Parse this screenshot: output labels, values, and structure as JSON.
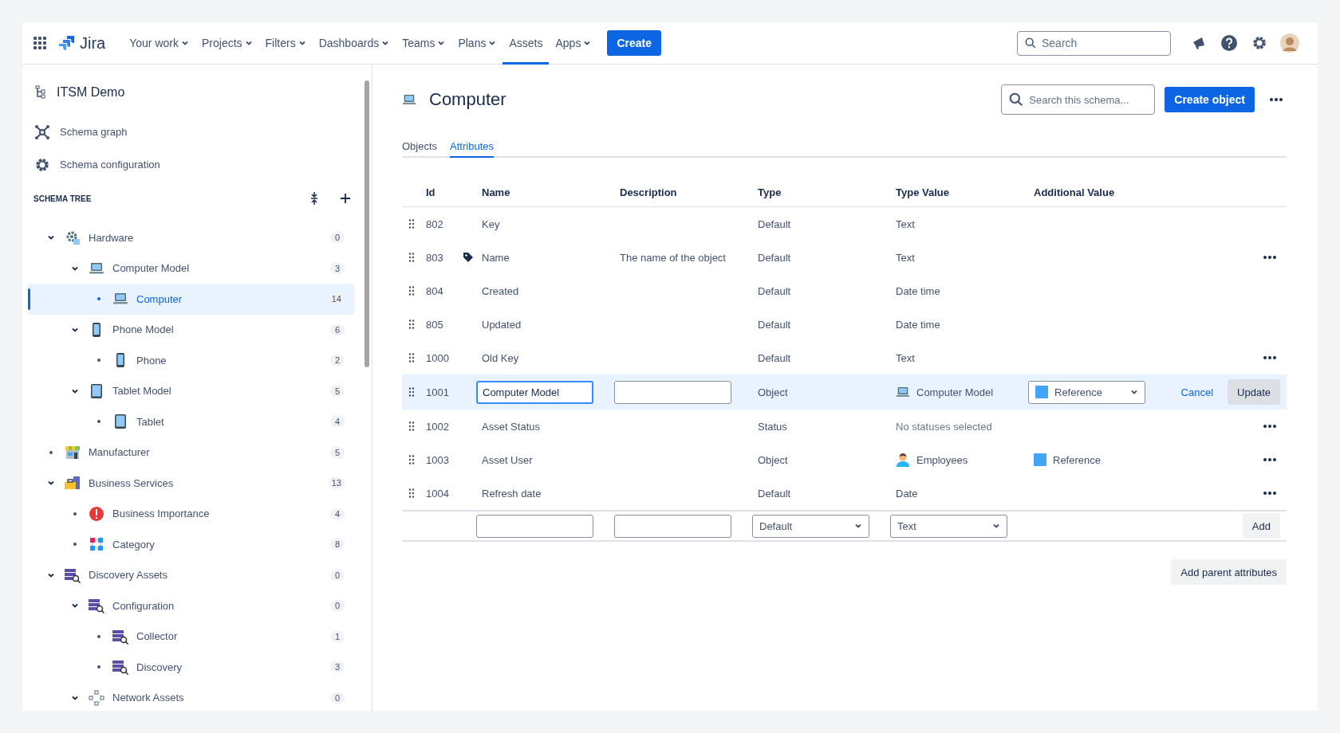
{
  "nav": {
    "product": "Jira",
    "items": [
      {
        "label": "Your work",
        "dropdown": true,
        "selected": false
      },
      {
        "label": "Projects",
        "dropdown": true,
        "selected": false
      },
      {
        "label": "Filters",
        "dropdown": true,
        "selected": false
      },
      {
        "label": "Dashboards",
        "dropdown": true,
        "selected": false
      },
      {
        "label": "Teams",
        "dropdown": true,
        "selected": false
      },
      {
        "label": "Plans",
        "dropdown": true,
        "selected": false
      },
      {
        "label": "Assets",
        "dropdown": false,
        "selected": true
      },
      {
        "label": "Apps",
        "dropdown": true,
        "selected": false
      }
    ],
    "create": "Create",
    "search": {
      "placeholder": "Search"
    }
  },
  "sidebar": {
    "schema": "ITSM Demo",
    "links": [
      {
        "label": "Schema graph",
        "kind": "graph"
      },
      {
        "label": "Schema configuration",
        "kind": "config"
      }
    ],
    "tree_title": "SCHEMA TREE",
    "tree": [
      {
        "label": "Hardware",
        "kind": "hardware",
        "count": "0",
        "selected": false,
        "expanded": true,
        "children": [
          {
            "label": "Computer Model",
            "kind": "computer",
            "count": "3",
            "selected": false,
            "expanded": true,
            "children": [
              {
                "label": "Computer",
                "kind": "computer",
                "count": "14",
                "selected": true
              }
            ]
          },
          {
            "label": "Phone Model",
            "kind": "phone",
            "count": "6",
            "selected": false,
            "expanded": true,
            "children": [
              {
                "label": "Phone",
                "kind": "phone",
                "count": "2",
                "selected": false
              }
            ]
          },
          {
            "label": "Tablet Model",
            "kind": "tablet",
            "count": "5",
            "selected": false,
            "expanded": true,
            "children": [
              {
                "label": "Tablet",
                "kind": "tablet",
                "count": "4",
                "selected": false
              }
            ]
          }
        ]
      },
      {
        "label": "Manufacturer",
        "kind": "store",
        "count": "5",
        "selected": false
      },
      {
        "label": "Business Services",
        "kind": "business",
        "count": "13",
        "selected": false,
        "expanded": true,
        "children": [
          {
            "label": "Business Importance",
            "kind": "alert",
            "count": "4",
            "selected": false
          },
          {
            "label": "Category",
            "kind": "category",
            "count": "8",
            "selected": false
          }
        ]
      },
      {
        "label": "Discovery Assets",
        "kind": "discovery",
        "count": "0",
        "selected": false,
        "expanded": true,
        "children": [
          {
            "label": "Configuration",
            "kind": "discovery",
            "count": "0",
            "selected": false,
            "expanded": true,
            "children": [
              {
                "label": "Collector",
                "kind": "discovery",
                "count": "1",
                "selected": false
              },
              {
                "label": "Discovery",
                "kind": "discovery",
                "count": "3",
                "selected": false
              }
            ]
          },
          {
            "label": "Network Assets",
            "kind": "network",
            "count": "0",
            "selected": false,
            "expanded": true
          }
        ]
      }
    ]
  },
  "main": {
    "title": "Computer",
    "search": {
      "placeholder": "Search this schema..."
    },
    "create": "Create object",
    "tabs": [
      {
        "label": "Objects",
        "selected": false
      },
      {
        "label": "Attributes",
        "selected": true
      }
    ],
    "columns": [
      "Id",
      "Name",
      "Description",
      "Type",
      "Type Value",
      "Additional Value"
    ],
    "rows": [
      {
        "kind": "view",
        "id": "802",
        "name": "Key",
        "label_attribute": false,
        "description": "",
        "type": "Default",
        "type_value": "Text",
        "type_value_icon": false,
        "muted": false,
        "additional": "",
        "menu": false
      },
      {
        "kind": "view",
        "id": "803",
        "name": "Name",
        "label_attribute": true,
        "description": "The name of the object",
        "type": "Default",
        "type_value": "Text",
        "type_value_icon": false,
        "muted": false,
        "additional": "",
        "menu": true
      },
      {
        "kind": "view",
        "id": "804",
        "name": "Created",
        "label_attribute": false,
        "description": "",
        "type": "Default",
        "type_value": "Date time",
        "type_value_icon": false,
        "muted": false,
        "additional": "",
        "menu": false
      },
      {
        "kind": "view",
        "id": "805",
        "name": "Updated",
        "label_attribute": false,
        "description": "",
        "type": "Default",
        "type_value": "Date time",
        "type_value_icon": false,
        "muted": false,
        "additional": "",
        "menu": false
      },
      {
        "kind": "view",
        "id": "1000",
        "name": "Old Key",
        "label_attribute": false,
        "description": "",
        "type": "Default",
        "type_value": "Text",
        "type_value_icon": false,
        "muted": false,
        "additional": "",
        "menu": true
      },
      {
        "kind": "edit",
        "id": "1001",
        "name": "Computer Model",
        "description": "",
        "type": "Object",
        "type_value": "Computer Model",
        "type_value_icon": true,
        "additional": "Reference",
        "cancel": "Cancel",
        "update": "Update"
      },
      {
        "kind": "view",
        "id": "1002",
        "name": "Asset Status",
        "label_attribute": false,
        "description": "",
        "type": "Status",
        "type_value": "No statuses selected",
        "type_value_icon": false,
        "muted": true,
        "additional": "",
        "menu": true
      },
      {
        "kind": "view",
        "id": "1003",
        "name": "Asset User",
        "label_attribute": false,
        "description": "",
        "type": "Object",
        "type_value": "Employees",
        "type_value_icon": true,
        "muted": false,
        "additional": "Reference",
        "menu": true
      },
      {
        "kind": "view",
        "id": "1004",
        "name": "Refresh date",
        "label_attribute": false,
        "description": "",
        "type": "Default",
        "type_value": "Date",
        "type_value_icon": false,
        "muted": false,
        "additional": "",
        "menu": true
      }
    ],
    "new_row": {
      "type": "Default",
      "type_value": "Text",
      "add": "Add"
    },
    "parent_button": "Add parent attributes"
  }
}
